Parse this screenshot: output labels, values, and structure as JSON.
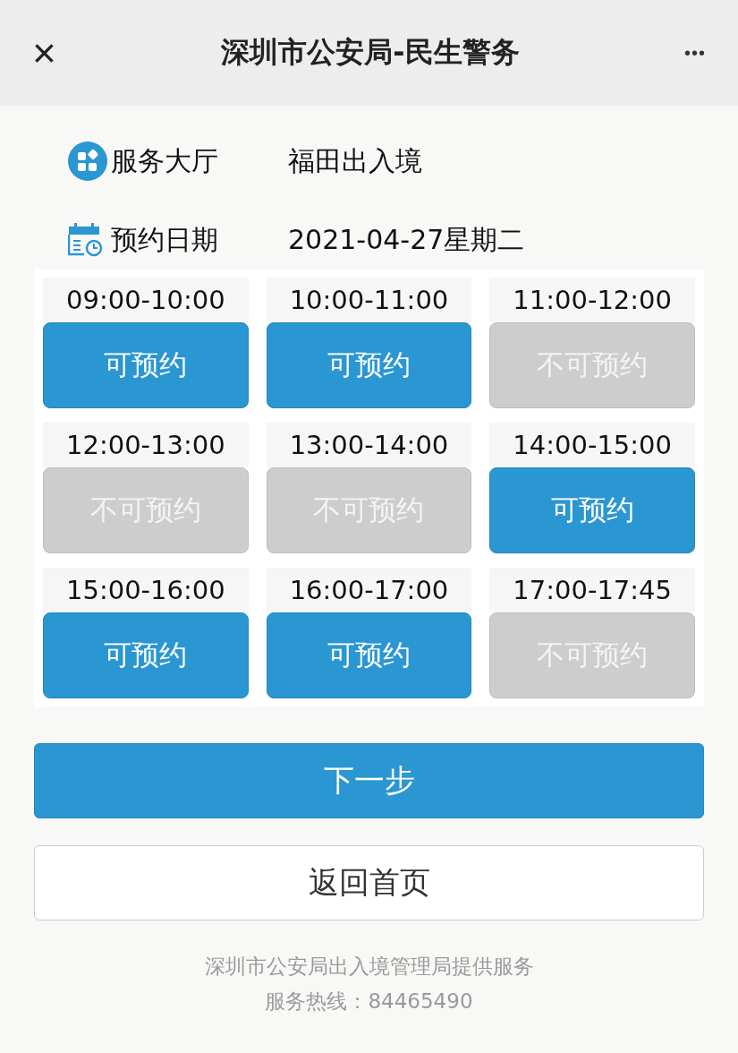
{
  "header": {
    "close_symbol": "×",
    "title": "深圳市公安局-民生警务",
    "more_symbol": "•••"
  },
  "info": [
    {
      "kind": "hall",
      "label": "服务大厅",
      "value": "福田出入境"
    },
    {
      "kind": "date",
      "label": "预约日期",
      "value": "2021-04-27星期二"
    }
  ],
  "slots": [
    {
      "time": "09:00-10:00",
      "status": "可预约",
      "available": true
    },
    {
      "time": "10:00-11:00",
      "status": "可预约",
      "available": true
    },
    {
      "time": "11:00-12:00",
      "status": "不可预约",
      "available": false
    },
    {
      "time": "12:00-13:00",
      "status": "不可预约",
      "available": false
    },
    {
      "time": "13:00-14:00",
      "status": "不可预约",
      "available": false
    },
    {
      "time": "14:00-15:00",
      "status": "可预约",
      "available": true
    },
    {
      "time": "15:00-16:00",
      "status": "可预约",
      "available": true
    },
    {
      "time": "16:00-17:00",
      "status": "可预约",
      "available": true
    },
    {
      "time": "17:00-17:45",
      "status": "不可预约",
      "available": false
    }
  ],
  "buttons": [
    {
      "kind": "primary",
      "label": "下一步"
    },
    {
      "kind": "secondary",
      "label": "返回首页"
    }
  ],
  "footer": [
    "深圳市公安局出入境管理局提供服务",
    "服务热线：84465490"
  ]
}
